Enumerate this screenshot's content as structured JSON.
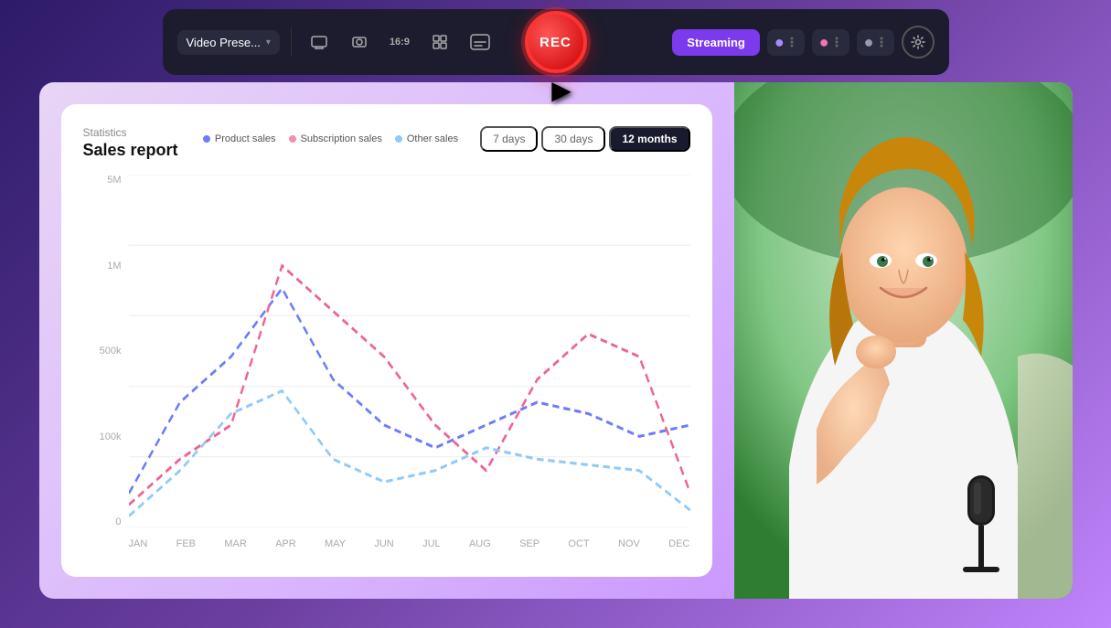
{
  "toolbar": {
    "preset_label": "Video Prese...",
    "rec_label": "REC",
    "streaming_label": "Streaming",
    "settings_label": "Settings",
    "ratio_label": "16:9"
  },
  "chart": {
    "stat_label": "Statistics",
    "title": "Sales report",
    "legend": [
      {
        "id": "product",
        "label": "Product sales",
        "color": "#6b7cff"
      },
      {
        "id": "subscription",
        "label": "Subscription sales",
        "color": "#f48fb1"
      },
      {
        "id": "other",
        "label": "Other sales",
        "color": "#90caf9"
      }
    ],
    "time_filters": [
      {
        "id": "7d",
        "label": "7 days",
        "active": false
      },
      {
        "id": "30d",
        "label": "30 days",
        "active": false
      },
      {
        "id": "12m",
        "label": "12 months",
        "active": true
      }
    ],
    "y_labels": [
      "5M",
      "1M",
      "500k",
      "100k",
      "0"
    ],
    "x_labels": [
      "JAN",
      "FEB",
      "MAR",
      "APR",
      "MAY",
      "JUN",
      "JUL",
      "AUG",
      "SEP",
      "OCT",
      "NOV",
      "DEC"
    ]
  }
}
